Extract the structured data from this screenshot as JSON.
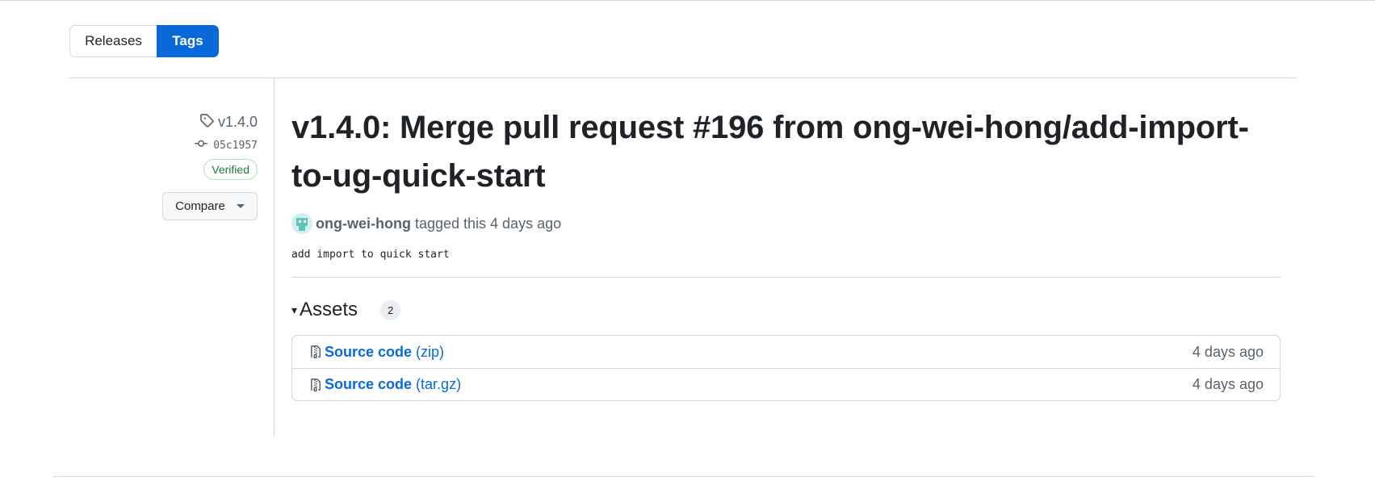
{
  "tabs": {
    "releases": "Releases",
    "tags": "Tags",
    "active": "tags"
  },
  "sidebar": {
    "tag": "v1.4.0",
    "commit": "05c1957",
    "verified": "Verified",
    "compare": "Compare"
  },
  "release": {
    "title": "v1.4.0: Merge pull request #196 from ong-wei-hong/add-import-to-ug-quick-start",
    "author": "ong-wei-hong",
    "tagged_text": "tagged this 4 days ago",
    "description": "add import to quick start"
  },
  "assets": {
    "toggle": "▾",
    "title": "Assets",
    "count": "2",
    "items": [
      {
        "label": "Source code",
        "ext": "(zip)",
        "date": "4 days ago"
      },
      {
        "label": "Source code",
        "ext": "(tar.gz)",
        "date": "4 days ago"
      }
    ]
  },
  "colors": {
    "accent": "#0969da",
    "verified": "#1a7f37",
    "muted": "#59636e",
    "border": "#d0d7de"
  },
  "icons": {
    "tag": "tag-icon",
    "commit": "git-commit-icon",
    "archive": "file-zip-icon",
    "caret": "triangle-down-icon"
  }
}
